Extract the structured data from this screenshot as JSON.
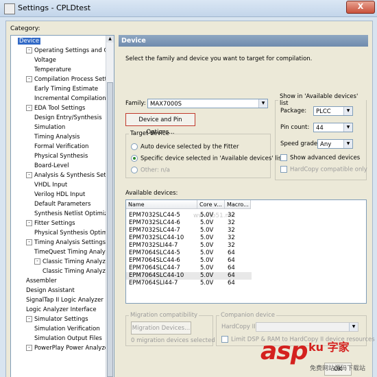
{
  "window": {
    "title": "Settings - CPLDtest",
    "close_glyph": "X"
  },
  "category_label": "Category:",
  "tree": [
    {
      "label": "Device",
      "selected": true,
      "toggle": ""
    },
    {
      "label": "Operating Settings and Conditions",
      "toggle": "-"
    },
    {
      "label": "Voltage",
      "toggle": ""
    },
    {
      "label": "Temperature",
      "toggle": ""
    },
    {
      "label": "Compilation Process Settings",
      "toggle": "-"
    },
    {
      "label": "Early Timing Estimate",
      "toggle": ""
    },
    {
      "label": "Incremental Compilation",
      "toggle": ""
    },
    {
      "label": "EDA Tool Settings",
      "toggle": "-"
    },
    {
      "label": "Design Entry/Synthesis",
      "toggle": ""
    },
    {
      "label": "Simulation",
      "toggle": ""
    },
    {
      "label": "Timing Analysis",
      "toggle": ""
    },
    {
      "label": "Formal Verification",
      "toggle": ""
    },
    {
      "label": "Physical Synthesis",
      "toggle": ""
    },
    {
      "label": "Board-Level",
      "toggle": ""
    },
    {
      "label": "Analysis & Synthesis Settings",
      "toggle": "-"
    },
    {
      "label": "VHDL Input",
      "toggle": ""
    },
    {
      "label": "Verilog HDL Input",
      "toggle": ""
    },
    {
      "label": "Default Parameters",
      "toggle": ""
    },
    {
      "label": "Synthesis Netlist Optimizations",
      "toggle": ""
    },
    {
      "label": "Fitter Settings",
      "toggle": "-"
    },
    {
      "label": "Physical Synthesis Optimizations",
      "toggle": ""
    },
    {
      "label": "Timing Analysis Settings",
      "toggle": "-"
    },
    {
      "label": "TimeQuest Timing Analyzer",
      "toggle": ""
    },
    {
      "label": "Classic Timing Analyzer Settings",
      "toggle": "-"
    },
    {
      "label": "Classic Timing Analyzer Reports",
      "toggle": ""
    },
    {
      "label": "Assembler",
      "toggle": ""
    },
    {
      "label": "Design Assistant",
      "toggle": ""
    },
    {
      "label": "SignalTap II Logic Analyzer",
      "toggle": ""
    },
    {
      "label": "Logic Analyzer Interface",
      "toggle": ""
    },
    {
      "label": "Simulator Settings",
      "toggle": "-"
    },
    {
      "label": "Simulation Verification",
      "toggle": ""
    },
    {
      "label": "Simulation Output Files",
      "toggle": ""
    },
    {
      "label": "PowerPlay Power Analyzer Settings",
      "toggle": "-"
    }
  ],
  "panel": {
    "header": "Device",
    "instruction": "Select the family and device you want to target for compilation.",
    "family_label": "Family:",
    "family_value": "MAX7000S",
    "device_pin_button": "Device and Pin Options...",
    "target_device": {
      "legend": "Target device",
      "auto": "Auto device selected by the Fitter",
      "specific": "Specific device selected in 'Available devices' list",
      "other": "Other:  n/a"
    },
    "show_in": {
      "legend": "Show in 'Available devices' list",
      "package_label": "Package:",
      "package_value": "PLCC",
      "pincount_label": "Pin count:",
      "pincount_value": "44",
      "speed_label": "Speed grade:",
      "speed_value": "Any",
      "show_advanced": "Show advanced devices",
      "hardcopy_compatible": "HardCopy compatible only"
    },
    "available_label": "Available devices:",
    "columns": [
      "Name",
      "Core v...",
      "Macro..."
    ],
    "devices": [
      {
        "name": "EPM7032SLC44-5",
        "core": "5.0V",
        "macro": "32"
      },
      {
        "name": "EPM7032SLC44-6",
        "core": "5.0V",
        "macro": "32"
      },
      {
        "name": "EPM7032SLC44-7",
        "core": "5.0V",
        "macro": "32"
      },
      {
        "name": "EPM7032SLC44-10",
        "core": "5.0V",
        "macro": "32"
      },
      {
        "name": "EPM7032SLI44-7",
        "core": "5.0V",
        "macro": "32"
      },
      {
        "name": "EPM7064SLC44-5",
        "core": "5.0V",
        "macro": "64"
      },
      {
        "name": "EPM7064SLC44-6",
        "core": "5.0V",
        "macro": "64"
      },
      {
        "name": "EPM7064SLC44-7",
        "core": "5.0V",
        "macro": "64"
      },
      {
        "name": "EPM7064SLC44-10",
        "core": "5.0V",
        "macro": "64"
      },
      {
        "name": "EPM7064SLI44-7",
        "core": "5.0V",
        "macro": "64"
      }
    ],
    "migration": {
      "legend": "Migration compatibility",
      "button": "Migration Devices...",
      "status": "0 migration devices selected"
    },
    "companion": {
      "legend": "Companion device",
      "hardcopy_label": "HardCopy II:",
      "limit": "Limit DSP & RAM to HardCopy II device resources"
    },
    "watermark_url": "www.jb51.net",
    "ok_button": "OK"
  },
  "brand_watermark": {
    "text": "asp",
    "cn": "ku 字家",
    "sub": "免费网站源码下载站"
  }
}
